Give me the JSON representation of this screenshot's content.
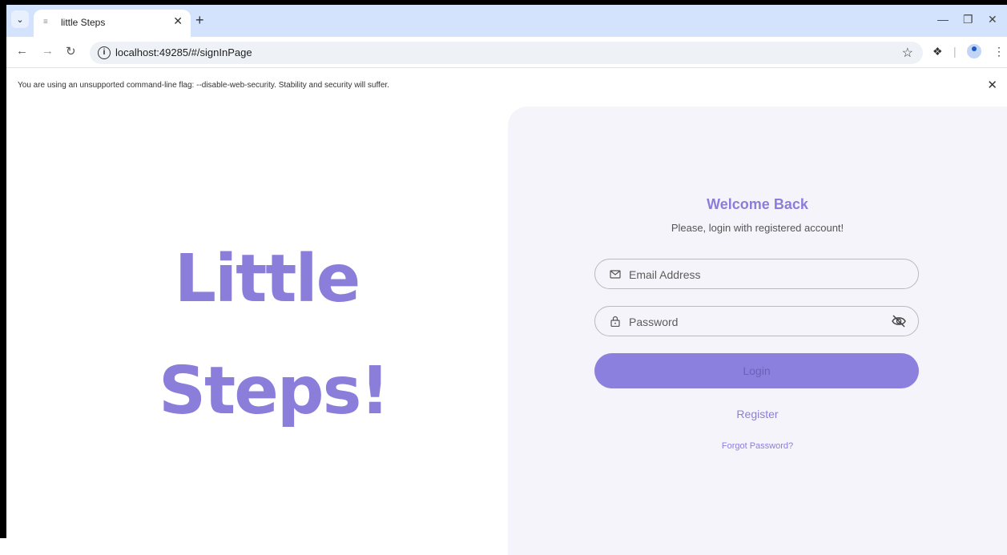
{
  "browser": {
    "tab_title": "little Steps",
    "url": "localhost:49285/#/signInPage",
    "infobar_message": "You are using an unsupported command-line flag: --disable-web-security. Stability and security will suffer."
  },
  "app": {
    "brand_line1": "Little",
    "brand_line2": "Steps!",
    "welcome": "Welcome Back",
    "subtitle": "Please, login with registered account!",
    "email_placeholder": "Email Address",
    "password_placeholder": "Password",
    "login_label": "Login",
    "register_label": "Register",
    "forgot_label": "Forgot Password?"
  },
  "colors": {
    "accent": "#8b7edb",
    "panel_bg": "#f5f4fa",
    "tabstrip_bg": "#d3e3fd"
  },
  "icons": [
    "chevron-down-icon",
    "favicon-icon",
    "close-icon",
    "plus-icon",
    "minimize-icon",
    "restore-icon",
    "back-icon",
    "forward-icon",
    "reload-icon",
    "info-icon",
    "star-icon",
    "extensions-icon",
    "profile-icon",
    "menu-icon",
    "mail-icon",
    "lock-icon",
    "eye-off-icon"
  ]
}
